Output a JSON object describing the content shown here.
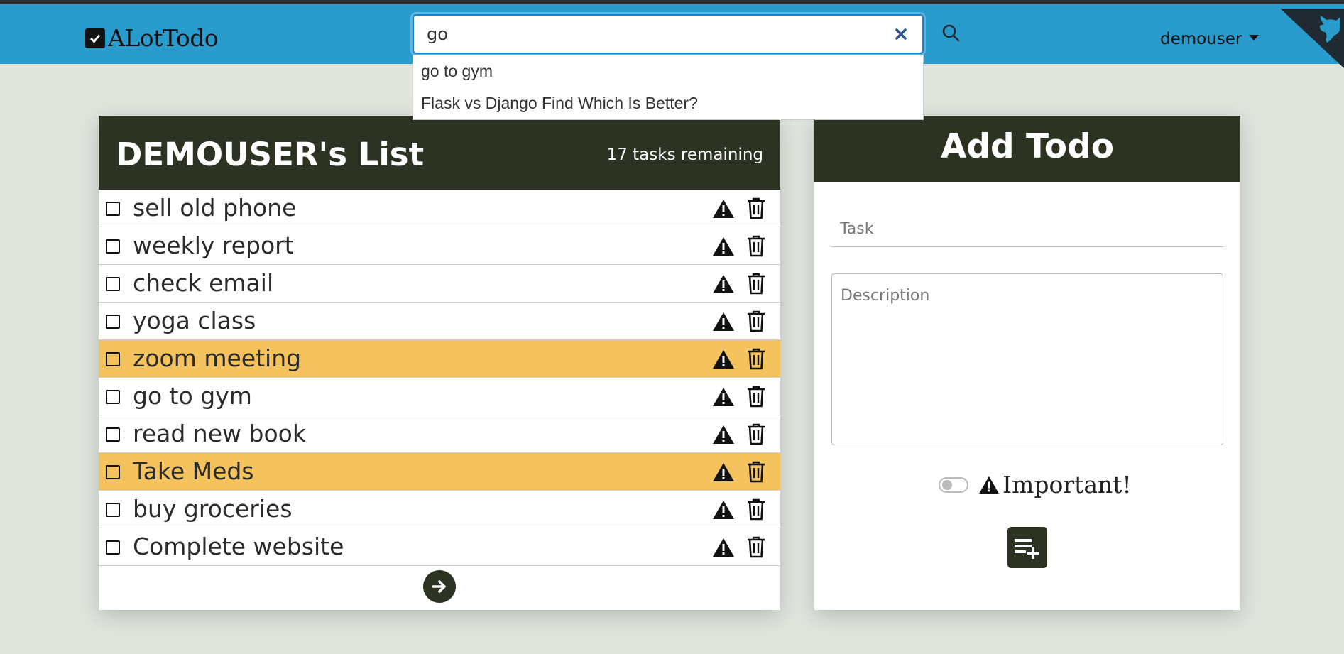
{
  "app": {
    "brand": "ALotTodo"
  },
  "search": {
    "value": "go",
    "suggestions": [
      "go to gym",
      "Flask vs Django Find Which Is Better?"
    ]
  },
  "user": {
    "name": "demouser"
  },
  "list": {
    "title": "DEMOUSER's List",
    "remaining": "17 tasks remaining",
    "items": [
      {
        "label": "sell old phone",
        "important": false
      },
      {
        "label": "weekly report",
        "important": false
      },
      {
        "label": "check email",
        "important": false
      },
      {
        "label": "yoga class",
        "important": false
      },
      {
        "label": "zoom meeting",
        "important": true
      },
      {
        "label": "go to gym",
        "important": false
      },
      {
        "label": "read new book",
        "important": false
      },
      {
        "label": "Take Meds",
        "important": true
      },
      {
        "label": "buy groceries",
        "important": false
      },
      {
        "label": "Complete website",
        "important": false
      }
    ]
  },
  "add_form": {
    "title": "Add Todo",
    "task_placeholder": "Task",
    "description_placeholder": "Description",
    "important_label": "Important!",
    "important_checked": false
  },
  "colors": {
    "navbar": "#2a9bcd",
    "dark": "#2d3322",
    "important_row": "#f4c35e",
    "background": "#dfe5dd"
  },
  "icons": {
    "brand": "checkbox-icon",
    "search": "search-icon",
    "clear": "close-icon",
    "warning": "warning-icon",
    "delete": "trash-icon",
    "next": "arrow-right-icon",
    "add": "playlist-add-icon"
  }
}
